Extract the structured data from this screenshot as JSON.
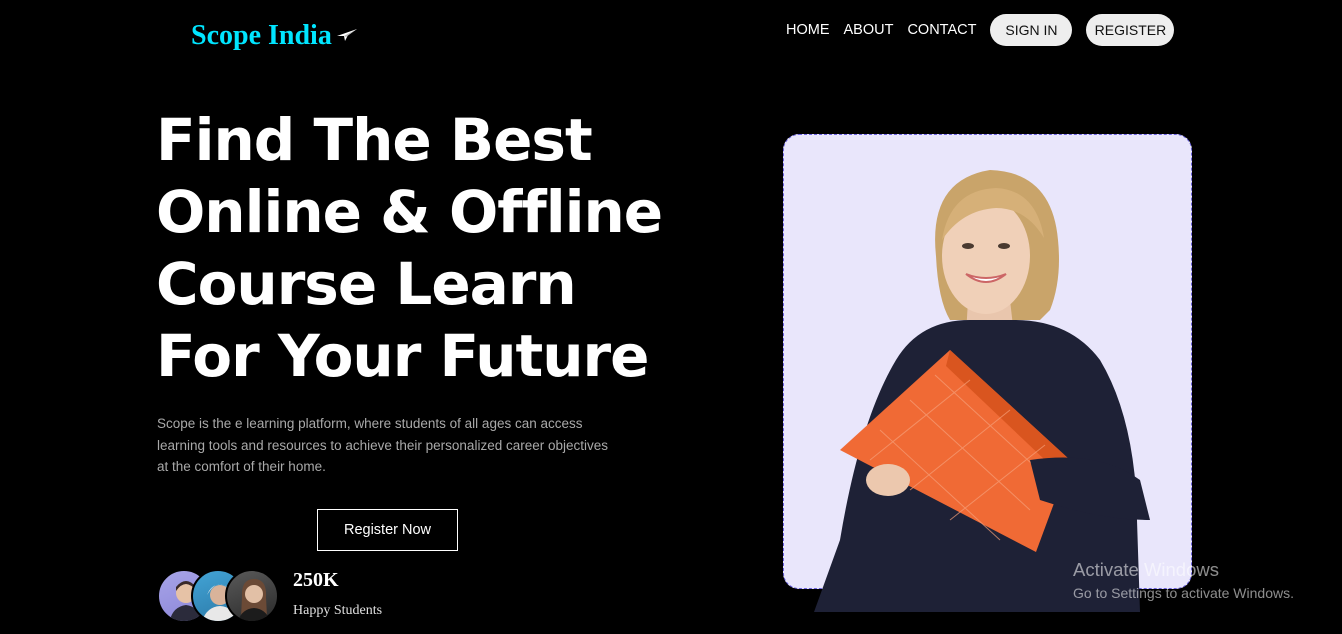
{
  "header": {
    "logo_text": "Scope India",
    "logo_icon": "paper-plane-icon",
    "nav": {
      "home": "HOME",
      "about": "ABOUT",
      "contact": "CONTACT",
      "signin": "SIGN IN",
      "register": "REGISTER"
    }
  },
  "hero": {
    "title_lines": [
      "Find The Best",
      "Online & Offline",
      "Course Learn",
      "For Your Future"
    ],
    "description": "Scope is the e learning platform, where students of all ages can access learning tools and resources to achieve their personalized career objectives at the comfort of their home.",
    "cta_label": "Register Now",
    "stats": {
      "number": "250K",
      "label": "Happy Students"
    }
  },
  "watermark": {
    "title": "Activate Windows",
    "subtitle": "Go to Settings to activate Windows."
  },
  "colors": {
    "background": "#000000",
    "logo": "#00e5ff",
    "card_background": "#e9e6fb",
    "card_border": "#6b62e0",
    "nav_button": "#eeeeee"
  }
}
